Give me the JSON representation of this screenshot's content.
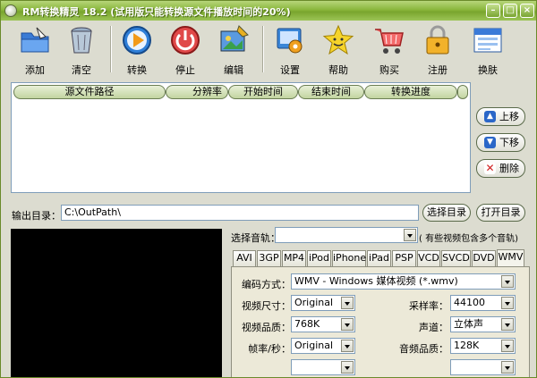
{
  "window": {
    "title": "RM转换精灵 18.2 (试用版只能转换源文件播放时间的20%)",
    "minimize": "–",
    "maximize": "□",
    "close": "×"
  },
  "toolbar": {
    "add": "添加",
    "clear": "清空",
    "convert": "转换",
    "stop": "停止",
    "edit": "编辑",
    "settings": "设置",
    "help": "帮助",
    "buy": "购买",
    "register": "注册",
    "skin": "换肤"
  },
  "list": {
    "columns": [
      "源文件路径",
      "分辨率",
      "开始时间",
      "结束时间",
      "转换进度"
    ]
  },
  "side": {
    "up": "上移",
    "down": "下移",
    "delete": "删除"
  },
  "output": {
    "label": "输出目录：",
    "path": "C:\\OutPath\\",
    "choose": "选择目录",
    "open": "打开目录"
  },
  "audio_track": {
    "label": "选择音轨：",
    "value": "",
    "hint": "( 有些视频包含多个音轨)"
  },
  "formats": [
    "AVI",
    "3GP",
    "MP4",
    "iPod",
    "iPhone",
    "iPad",
    "PSP",
    "VCD",
    "SVCD",
    "DVD",
    "WMV"
  ],
  "settings_panel": {
    "encoding_label": "编码方式：",
    "encoding_value": "WMV - Windows 媒体视频 (*.wmv)",
    "video_size_label": "视频尺寸：",
    "video_size_value": "Original",
    "sample_rate_label": "采样率：",
    "sample_rate_value": "44100",
    "video_quality_label": "视频品质：",
    "video_quality_value": "768K",
    "channel_label": "声道：",
    "channel_value": "立体声",
    "fps_label": "帧率/秒：",
    "fps_value": "Original",
    "audio_quality_label": "音频品质：",
    "audio_quality_value": "128K"
  }
}
